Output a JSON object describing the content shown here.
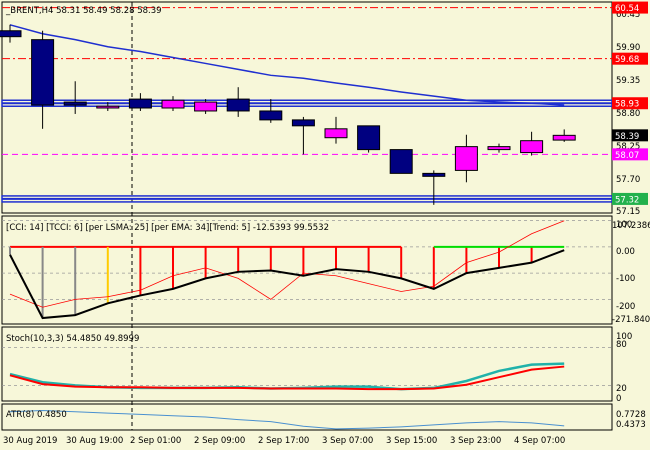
{
  "colors": {
    "background": "#f7f7d9",
    "bull_candle": "#ff00ff",
    "bear_candle": "#000080",
    "ma": "#1f2fd0",
    "red": "#ff0000",
    "green": "#00dd00",
    "teal": "#20b2aa",
    "atr": "#4a90d0"
  },
  "main": {
    "title": "_BRENT,H4  58.31 58.49 58.28 58.39",
    "price_labels": [
      "60.45",
      "59.90",
      "59.35",
      "58.80",
      "58.25",
      "57.70",
      "57.15"
    ],
    "badges": [
      {
        "text": "60.54",
        "price": 60.54,
        "bg": "#ff0000"
      },
      {
        "text": "59.68",
        "price": 59.68,
        "bg": "#ff0000"
      },
      {
        "text": "58.93",
        "price": 58.93,
        "bg": "#ff0000"
      },
      {
        "text": "58.39",
        "price": 58.39,
        "bg": "#000000"
      },
      {
        "text": "58.07",
        "price": 58.07,
        "bg": "#ff00ff"
      },
      {
        "text": "57.32",
        "price": 57.32,
        "bg": "#22b14c"
      }
    ],
    "levels": [
      {
        "price": 60.54,
        "style": "dashdot",
        "color": "#ff0000"
      },
      {
        "price": 59.68,
        "style": "dashdot",
        "color": "#ff0000"
      },
      {
        "price": 58.93,
        "style": "band",
        "color": "#1f2fd0"
      },
      {
        "price": 58.07,
        "style": "dash",
        "color": "#ff00ff"
      },
      {
        "price": 57.32,
        "style": "band",
        "color": "#1f2fd0"
      }
    ]
  },
  "cci_panel": {
    "title": "[CCI: 14] [TCCI: 6] [per LSMA: 25] [per EMA: 34][Trend: 5]  -12.5393 99.5532",
    "labels": [
      "107.2386",
      "100",
      "0.00",
      "-100",
      "-200",
      "-271.840"
    ]
  },
  "stoch_panel": {
    "title": "Stoch(10,3,3) 54.4850 49.8999",
    "labels": [
      "100",
      "80",
      "20",
      "0"
    ]
  },
  "atr_panel": {
    "title": "ATR(8) 0.4850",
    "labels": [
      "0.7728",
      "0.4373"
    ]
  },
  "time_labels": [
    "30 Aug 2019",
    "30 Aug 19:00",
    "2 Sep 01:00",
    "2 Sep 09:00",
    "2 Sep 17:00",
    "3 Sep 07:00",
    "3 Sep 15:00",
    "3 Sep 23:00",
    "4 Sep 07:00"
  ],
  "chart_data": [
    {
      "type": "candlestick",
      "symbol": "_BRENT",
      "timeframe": "H4",
      "ohlc_last": {
        "open": 58.31,
        "high": 58.49,
        "low": 58.28,
        "close": 58.39
      },
      "candles": [
        {
          "o": 60.15,
          "h": 60.25,
          "l": 59.95,
          "c": 60.05
        },
        {
          "o": 60.0,
          "h": 60.15,
          "l": 58.5,
          "c": 58.9
        },
        {
          "o": 58.95,
          "h": 59.3,
          "l": 58.75,
          "c": 58.9
        },
        {
          "o": 58.85,
          "h": 58.95,
          "l": 58.8,
          "c": 58.88
        },
        {
          "o": 59.0,
          "h": 59.1,
          "l": 58.8,
          "c": 58.85
        },
        {
          "o": 58.85,
          "h": 59.05,
          "l": 58.8,
          "c": 58.98
        },
        {
          "o": 58.8,
          "h": 59.0,
          "l": 58.75,
          "c": 58.95
        },
        {
          "o": 59.0,
          "h": 59.2,
          "l": 58.7,
          "c": 58.8
        },
        {
          "o": 58.8,
          "h": 59.0,
          "l": 58.6,
          "c": 58.65
        },
        {
          "o": 58.65,
          "h": 58.7,
          "l": 58.07,
          "c": 58.55
        },
        {
          "o": 58.35,
          "h": 58.7,
          "l": 58.25,
          "c": 58.5
        },
        {
          "o": 58.55,
          "h": 58.55,
          "l": 58.1,
          "c": 58.15
        },
        {
          "o": 58.15,
          "h": 58.15,
          "l": 57.75,
          "c": 57.75
        },
        {
          "o": 57.75,
          "h": 57.8,
          "l": 57.22,
          "c": 57.7
        },
        {
          "o": 57.8,
          "h": 58.4,
          "l": 57.6,
          "c": 58.2
        },
        {
          "o": 58.15,
          "h": 58.25,
          "l": 58.1,
          "c": 58.2
        },
        {
          "o": 58.1,
          "h": 58.45,
          "l": 58.05,
          "c": 58.3
        },
        {
          "o": 58.31,
          "h": 58.49,
          "l": 58.28,
          "c": 58.39
        }
      ],
      "moving_average": [
        60.25,
        60.1,
        60.0,
        59.88,
        59.8,
        59.7,
        59.6,
        59.5,
        59.4,
        59.35,
        59.27,
        59.2,
        59.12,
        59.05,
        58.98,
        58.95,
        58.93,
        58.9
      ],
      "y_range": [
        57.1,
        60.6
      ]
    },
    {
      "type": "line",
      "name": "CCI",
      "values": {
        "value1": -12.5393,
        "value2": 99.5532
      },
      "y_range": [
        -290,
        110
      ],
      "levels": [
        100,
        0,
        -100,
        -200
      ],
      "black_line": [
        -30,
        -271,
        -260,
        -215,
        -185,
        -160,
        -120,
        -95,
        -90,
        -110,
        -85,
        -95,
        -120,
        -160,
        -100,
        -80,
        -60,
        -12.54
      ],
      "red_line": [
        -180,
        -230,
        -200,
        -190,
        -165,
        -110,
        -80,
        -120,
        -200,
        -100,
        -110,
        -140,
        -170,
        -150,
        -60,
        -20,
        50,
        99.55
      ],
      "green_segment": [
        -20,
        -20,
        -20,
        -20
      ],
      "red_histogram_top": 0
    },
    {
      "type": "line",
      "name": "Stoch(10,3,3)",
      "values": {
        "main": 54.485,
        "signal": 49.8999
      },
      "y_range": [
        0,
        100
      ],
      "levels": [
        80,
        20
      ],
      "teal_line": [
        38,
        25,
        20,
        17,
        16,
        16,
        16,
        17,
        15,
        16,
        18,
        18,
        14,
        16,
        27,
        43,
        53,
        54.49
      ],
      "red_line": [
        36,
        22,
        18,
        17,
        17,
        16,
        16,
        16,
        15,
        15,
        15,
        14,
        14,
        15,
        21,
        33,
        45,
        49.9
      ]
    },
    {
      "type": "line",
      "name": "ATR(8)",
      "values": {
        "atr": 0.485
      },
      "y_range": [
        0.4373,
        0.7728
      ],
      "line": [
        0.7,
        0.72,
        0.7,
        0.68,
        0.66,
        0.64,
        0.62,
        0.58,
        0.55,
        0.48,
        0.44,
        0.45,
        0.47,
        0.5,
        0.53,
        0.55,
        0.53,
        0.485
      ]
    }
  ]
}
